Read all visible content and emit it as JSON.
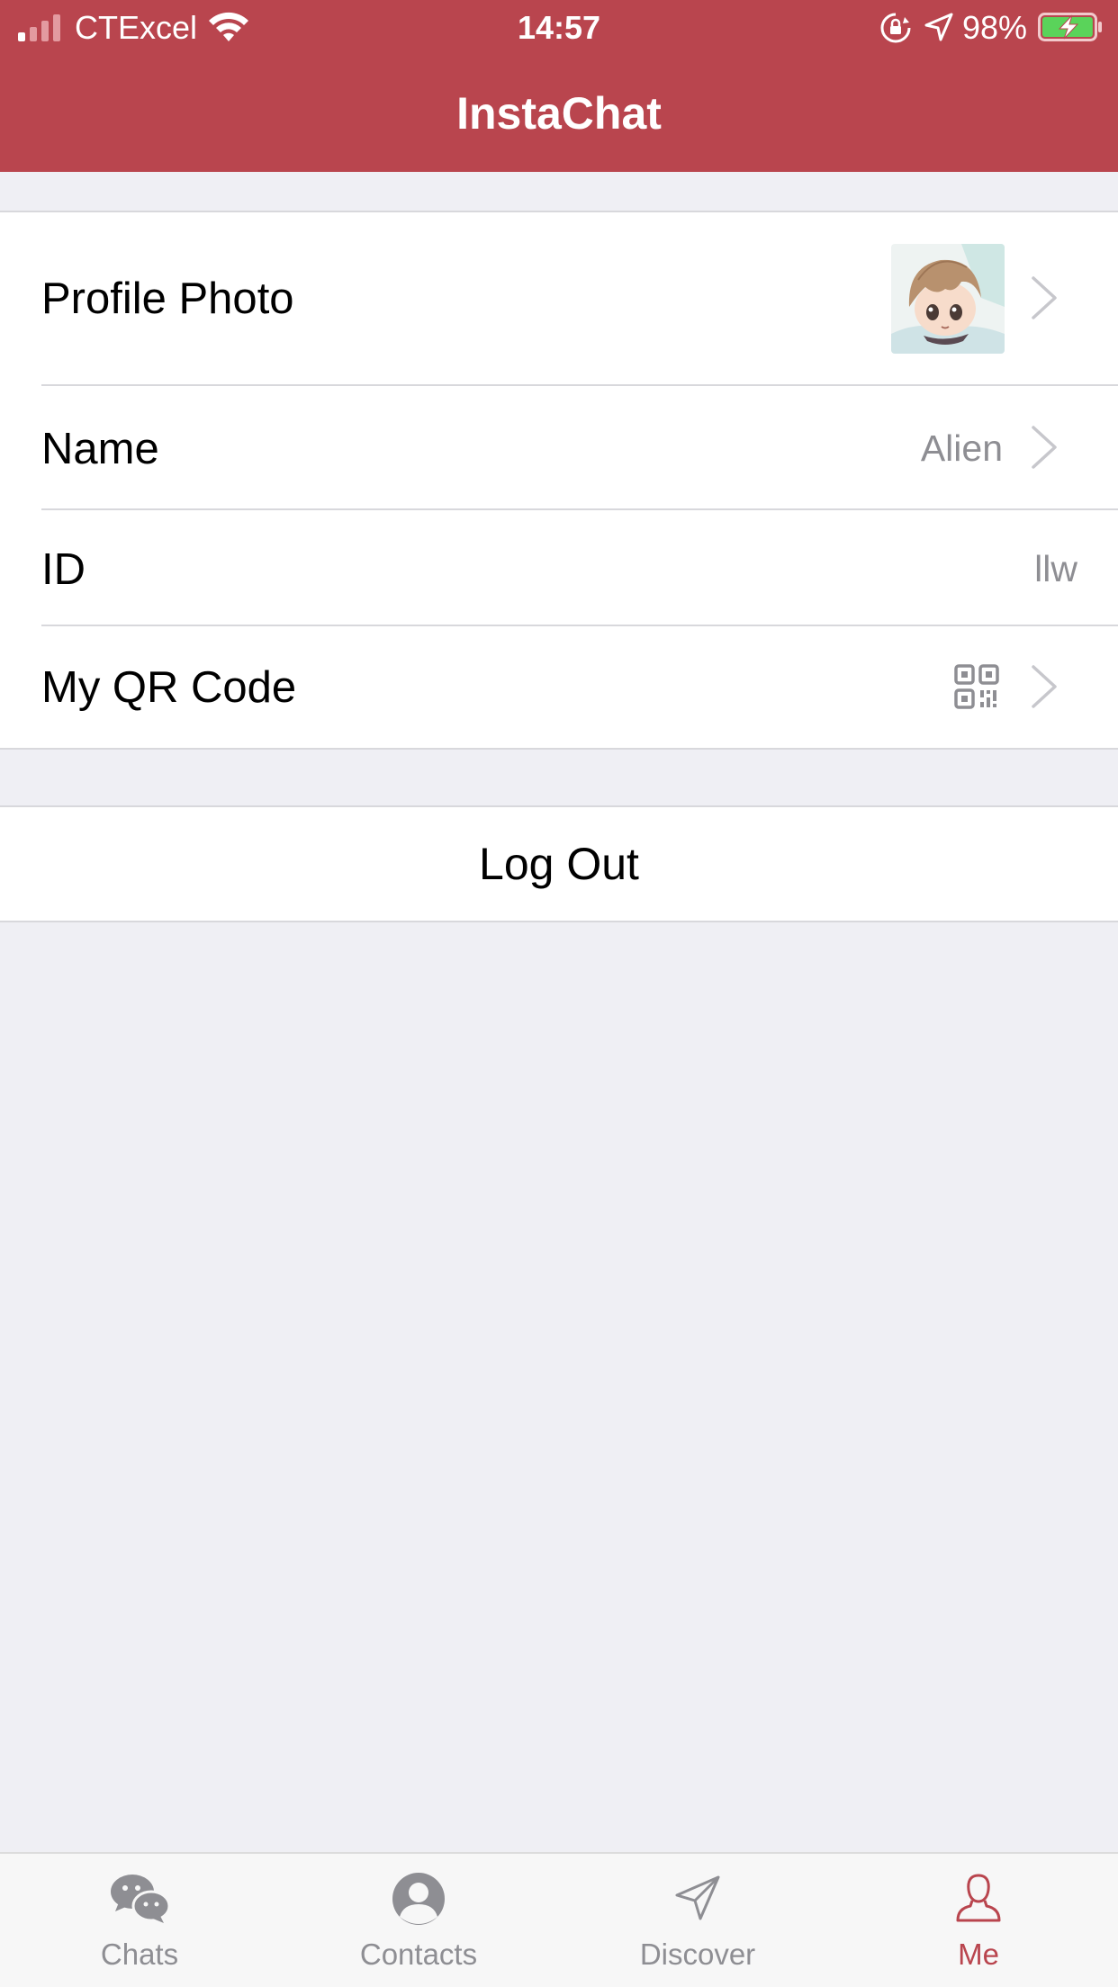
{
  "status_bar": {
    "carrier": "CTExcel",
    "time": "14:57",
    "battery_percent": "98%",
    "battery_level": 0.98,
    "signal_bars": 1
  },
  "nav": {
    "title": "InstaChat"
  },
  "profile": {
    "rows": [
      {
        "label": "Profile Photo",
        "value": "",
        "has_chevron": true
      },
      {
        "label": "Name",
        "value": "Alien",
        "has_chevron": true
      },
      {
        "label": "ID",
        "value": "llw",
        "has_chevron": false
      },
      {
        "label": "My QR Code",
        "value": "",
        "has_chevron": true
      }
    ]
  },
  "actions": {
    "logout_label": "Log Out"
  },
  "tabbar": {
    "tabs": [
      {
        "label": "Chats",
        "icon": "chats-icon",
        "active": false
      },
      {
        "label": "Contacts",
        "icon": "contacts-icon",
        "active": false
      },
      {
        "label": "Discover",
        "icon": "discover-icon",
        "active": false
      },
      {
        "label": "Me",
        "icon": "me-icon",
        "active": true
      }
    ]
  },
  "colors": {
    "accent": "#B9454E",
    "background": "#EFEFF4",
    "secondary_text": "#8E8E93"
  }
}
